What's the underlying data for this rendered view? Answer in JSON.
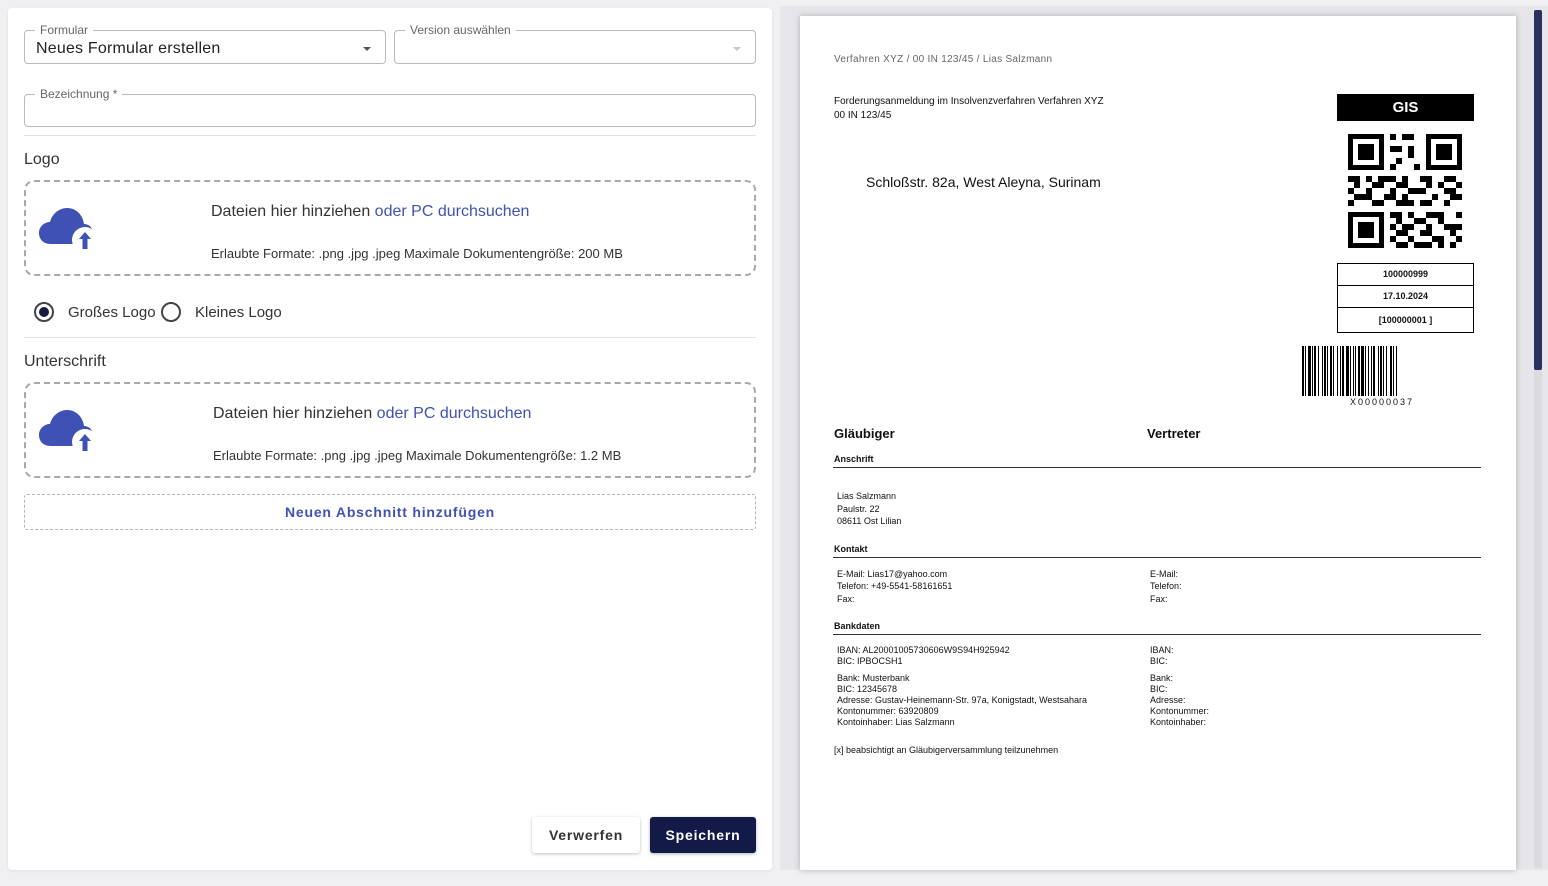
{
  "form": {
    "formular_label": "Formular",
    "formular_value": "Neues Formular erstellen",
    "version_label": "Version auswählen",
    "version_value": "",
    "bezeichnung_label": "Bezeichnung *",
    "bezeichnung_value": ""
  },
  "logo": {
    "title": "Logo",
    "drop_text": "Dateien hier hinziehen",
    "browse_link": "oder PC durchsuchen",
    "formats": "Erlaubte Formate: .png .jpg .jpeg Maximale Dokumentengröße: 200 MB",
    "radio_large": "Großes Logo",
    "radio_small": "Kleines Logo",
    "selected": "large"
  },
  "signature": {
    "title": "Unterschrift",
    "drop_text": "Dateien hier hinziehen",
    "browse_link": "oder PC durchsuchen",
    "formats": "Erlaubte Formate: .png .jpg .jpeg Maximale Dokumentengröße: 1.2 MB"
  },
  "add_section_label": "Neuen Abschnitt hinzufügen",
  "buttons": {
    "discard": "Verwerfen",
    "save": "Speichern"
  },
  "preview": {
    "header": "Verfahren XYZ / 00 IN 123/45 / Lias Salzmann",
    "title_line1": "Forderungsanmeldung im Insolvenzverfahren  Verfahren XYZ",
    "title_line2": "00 IN 123/45",
    "address": "Schloßstr. 82a, West Aleyna, Surinam",
    "badge": "GIS",
    "id_number": "100000999",
    "date": "17.10.2024",
    "ref": "[100000001 ]",
    "barcode_number": "X00000037",
    "col_creditor": "Gläubiger",
    "col_representative": "Vertreter",
    "sec_address": "Anschrift",
    "creditor_name": "Lias Salzmann",
    "creditor_street": "Paulstr. 22",
    "creditor_city": "08611 Ost Lilian",
    "sec_contact": "Kontakt",
    "email_left": "E-Mail: Lias17@yahoo.com",
    "phone_left": "Telefon: +49-5541-58161651",
    "fax_left": "Fax:",
    "email_right": "E-Mail:",
    "phone_right": "Telefon:",
    "fax_right": "Fax:",
    "sec_bank": "Bankdaten",
    "iban_left": "IBAN: AL20001005730606W9S94H925942",
    "bic_left": "BIC: IPBOCSH1",
    "iban_right": "IBAN:",
    "bic_right": "BIC:",
    "bank_left": "Bank: Musterbank",
    "bic2_left": "BIC: 12345678",
    "bank_addr_left": "Adresse: Gustav-Heinemann-Str. 97a, Konigstadt, Westsahara",
    "account_left": "Kontonummer: 63920809",
    "holder_left": "Kontoinhaber: Lias Salzmann",
    "bank_right": "Bank:",
    "bic2_right": "BIC:",
    "bank_addr_right": "Adresse:",
    "account_right": "Kontonummer:",
    "holder_right": "Kontoinhaber:",
    "meeting_note": "[x] beabsichtigt an Gläubigerversammlung teilzunehmen"
  },
  "colors": {
    "primary": "#141a47",
    "link": "#3f51b5",
    "icon": "#3f51b5"
  },
  "icons": [
    "cloud-upload-icon",
    "chevron-down-icon",
    "qr-code",
    "barcode"
  ]
}
